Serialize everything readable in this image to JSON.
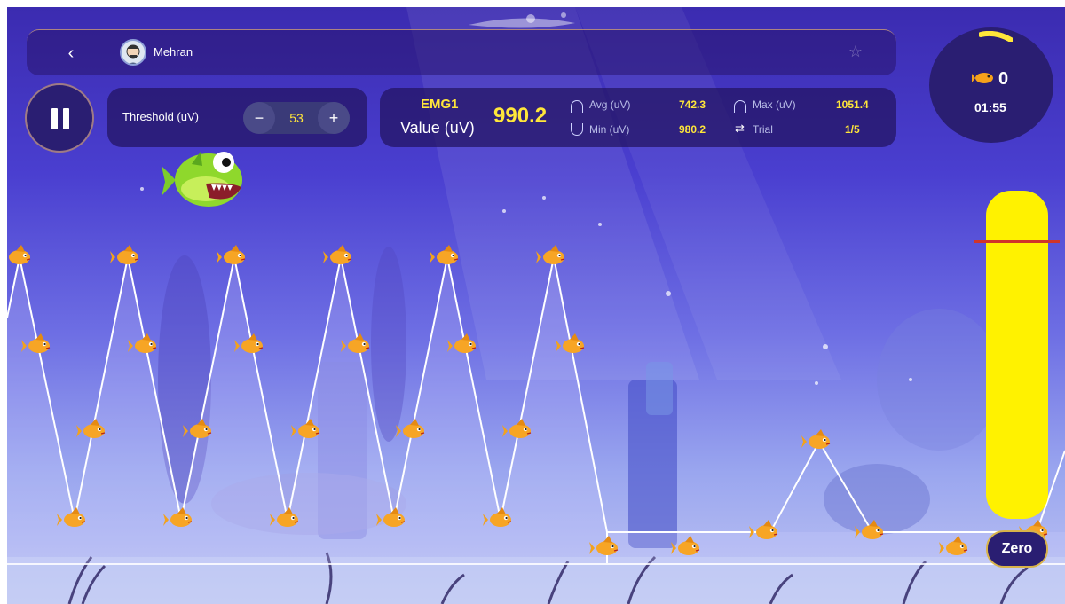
{
  "header": {
    "back_label": "‹",
    "user_name": "Mehran",
    "star_icon": "star-icon"
  },
  "controls": {
    "threshold_label": "Threshold (uV)",
    "minus_label": "−",
    "plus_label": "+",
    "threshold_value": "53"
  },
  "emg": {
    "channel": "EMG1",
    "value_label": "Value (uV)",
    "value": "990.2",
    "avg_label": "Avg (uV)",
    "avg_value": "742.3",
    "min_label": "Min (uV)",
    "min_value": "980.2",
    "max_label": "Max (uV)",
    "max_value": "1051.4",
    "trial_label": "Trial",
    "trial_value": "1/5"
  },
  "score": {
    "fish_count": "0",
    "timer": "01:55"
  },
  "zero_label": "Zero",
  "meter": {
    "level_fraction": 1.0
  },
  "colors": {
    "accent_yellow": "#ffe63a",
    "meter_yellow": "#fff200",
    "threshold_red": "#d0352a",
    "panel_dark": "#2a1e72"
  }
}
